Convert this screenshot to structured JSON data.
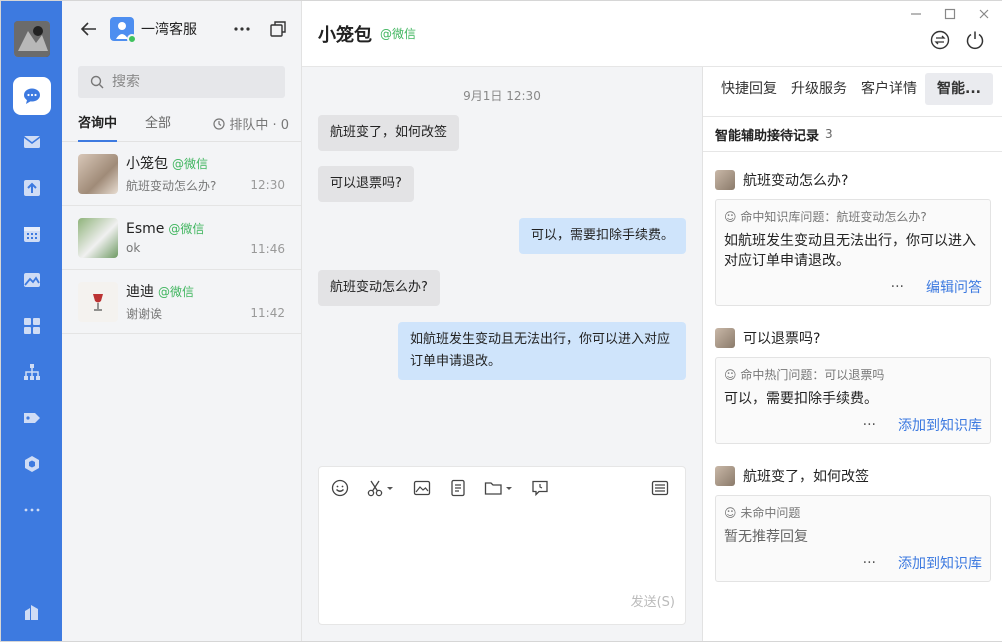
{
  "account": {
    "name": "一湾客服"
  },
  "search": {
    "placeholder": "搜索"
  },
  "tabs": {
    "active": "咨询中",
    "all": "全部",
    "queue": "排队中 · 0"
  },
  "sessions": [
    {
      "name": "小笼包",
      "channel": "@微信",
      "last": "航班变动怎么办?",
      "time": "12:30"
    },
    {
      "name": "Esme",
      "channel": "@微信",
      "last": "ok",
      "time": "11:46"
    },
    {
      "name": "迪迪",
      "channel": "@微信",
      "last": "谢谢诶",
      "time": "11:42"
    }
  ],
  "chat": {
    "title": "小笼包",
    "channel": "@微信",
    "timestamp": "9月1日 12:30",
    "messages": [
      {
        "dir": "in",
        "text": "航班变了，如何改签"
      },
      {
        "dir": "in",
        "text": "可以退票吗?"
      },
      {
        "dir": "out",
        "text": "可以，需要扣除手续费。"
      },
      {
        "dir": "in",
        "text": "航班变动怎么办?"
      },
      {
        "dir": "out",
        "text": "如航班发生变动且无法出行，你可以进入对应订单申请退改。"
      }
    ],
    "send_label": "发送(S)"
  },
  "panel": {
    "tabs": [
      "快捷回复",
      "升级服务",
      "客户详情",
      "智能..."
    ],
    "title": "智能辅助接待记录",
    "count": "3",
    "records": [
      {
        "question": "航班变动怎么办?",
        "hit": "命中知识库问题：航班变动怎么办?",
        "answer": "如航班发生变动且无法出行，你可以进入对应订单申请退改。",
        "more": "···",
        "action": "编辑问答"
      },
      {
        "question": "可以退票吗?",
        "hit": "命中热门问题：可以退票吗",
        "answer": "可以，需要扣除手续费。",
        "more": "···",
        "action": "添加到知识库"
      },
      {
        "question": "航班变了，如何改签",
        "hit": "未命中问题",
        "answer": "暂无推荐回复",
        "more": "···",
        "action": "添加到知识库"
      }
    ]
  },
  "colors": {
    "brand": "#3d7ae0",
    "wechat": "#3fb55e",
    "out_bubble": "#cfe4fb",
    "in_bubble": "#e3e3e5"
  },
  "icons": [
    "chat-icon",
    "mail-icon",
    "upload-icon",
    "calendar-icon",
    "image-icon",
    "apps-icon",
    "org-icon",
    "tag-icon",
    "cube-icon",
    "more-icon",
    "building-icon"
  ]
}
